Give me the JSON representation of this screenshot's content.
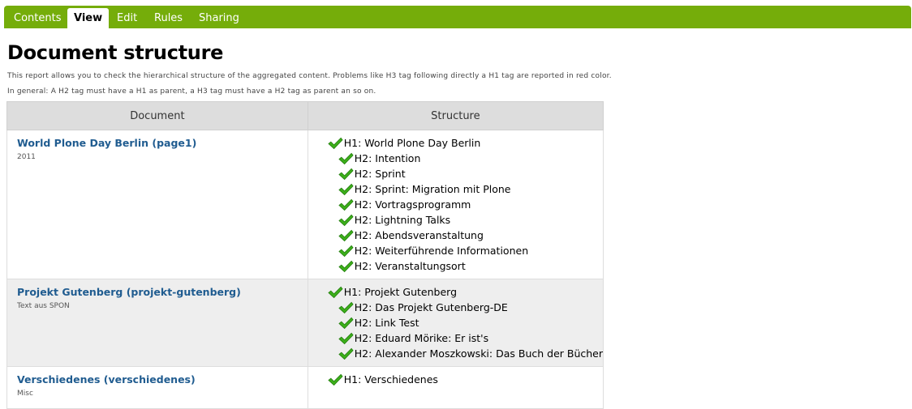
{
  "tabs": [
    {
      "label": "Contents",
      "active": false
    },
    {
      "label": "View",
      "active": true
    },
    {
      "label": "Edit",
      "active": false
    },
    {
      "label": "Rules",
      "active": false
    },
    {
      "label": "Sharing",
      "active": false
    }
  ],
  "title": "Document structure",
  "description": {
    "line1": "This report allows you to check the hierarchical structure of the aggregated content. Problems like H3 tag following directly a H1 tag are reported in red color.",
    "line2": "In general: A H2 tag must have a H1 as parent, a H3 tag must have a H2 tag as parent an so on."
  },
  "table": {
    "headers": {
      "document": "Document",
      "structure": "Structure"
    },
    "rows": [
      {
        "title": "World Plone Day Berlin (page1)",
        "description": "2011",
        "structure": [
          {
            "level": "h1",
            "text": "H1: World Plone Day Berlin"
          },
          {
            "level": "h2",
            "text": "H2: Intention"
          },
          {
            "level": "h2",
            "text": "H2: Sprint"
          },
          {
            "level": "h2",
            "text": "H2: Sprint: Migration mit Plone"
          },
          {
            "level": "h2",
            "text": "H2: Vortragsprogramm"
          },
          {
            "level": "h2",
            "text": "H2: Lightning Talks"
          },
          {
            "level": "h2",
            "text": "H2: Abendsveranstaltung"
          },
          {
            "level": "h2",
            "text": "H2: Weiterführende Informationen"
          },
          {
            "level": "h2",
            "text": "H2: Veranstaltungsort"
          }
        ]
      },
      {
        "title": "Projekt Gutenberg (projekt-gutenberg)",
        "description": "Text aus SPON",
        "structure": [
          {
            "level": "h1",
            "text": "H1: Projekt Gutenberg"
          },
          {
            "level": "h2",
            "text": "H2: Das Projekt Gutenberg-DE"
          },
          {
            "level": "h2",
            "text": "H2: Link Test"
          },
          {
            "level": "h2",
            "text": "H2: Eduard Mörike: Er ist's"
          },
          {
            "level": "h2",
            "text": "H2: Alexander Moszkowski: Das Buch der Bücher"
          }
        ]
      },
      {
        "title": "Verschiedenes (verschiedenes)",
        "description": "Misc",
        "structure": [
          {
            "level": "h1",
            "text": "H1: Verschiedenes"
          }
        ]
      }
    ]
  },
  "icons": {
    "status": "check-icon"
  },
  "colors": {
    "tab_bar": "#75ad0a",
    "link": "#205c90",
    "header_bg": "#dddddd",
    "alt_row_bg": "#eeeeee",
    "check_green": "#3cae1a"
  }
}
